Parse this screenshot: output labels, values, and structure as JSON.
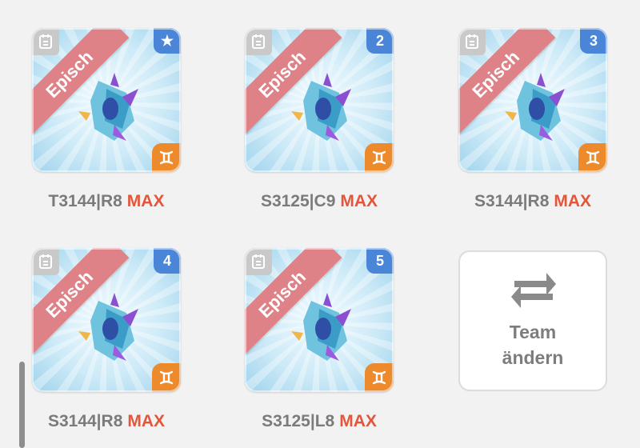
{
  "cards": [
    {
      "rarity": "Episch",
      "badge": "★",
      "badge_icon": "star-icon",
      "name": "T3144|R8",
      "max": "MAX"
    },
    {
      "rarity": "Episch",
      "badge": "2",
      "name": "S3125|C9",
      "max": "MAX"
    },
    {
      "rarity": "Episch",
      "badge": "3",
      "name": "S3144|R8",
      "max": "MAX"
    },
    {
      "rarity": "Episch",
      "badge": "4",
      "name": "S3144|R8",
      "max": "MAX"
    },
    {
      "rarity": "Episch",
      "badge": "5",
      "name": "S3125|L8",
      "max": "MAX"
    }
  ],
  "swap": {
    "line1": "Team",
    "line2": "ändern",
    "icon": "swap-arrows-icon"
  },
  "colors": {
    "ribbon": "#de8287",
    "badge_blue": "#4a85d8",
    "badge_orange": "#ec8a2c",
    "max": "#e4553a"
  }
}
